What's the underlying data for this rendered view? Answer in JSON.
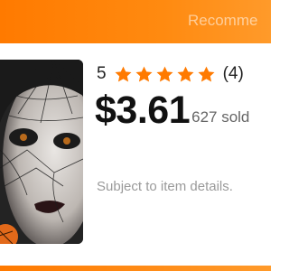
{
  "header": {
    "recommend_text": "Recomme",
    "accent_color": "#ff7a00"
  },
  "product": {
    "image_icon": "halloween-spiderweb-makeup-photo",
    "rating_score": "5",
    "stars_filled": 5,
    "stars_total": 5,
    "star_color": "#ff7a00",
    "review_count": "(4)",
    "price": "$3.61",
    "sold_text": "627 sold",
    "note": "Subject to item details."
  }
}
